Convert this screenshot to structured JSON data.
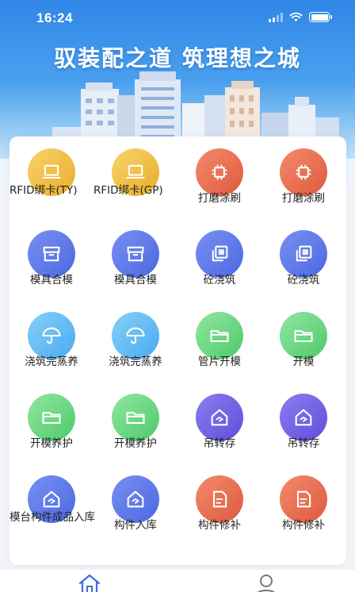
{
  "status": {
    "time": "16:24"
  },
  "header": {
    "slogan": "驭装配之道 筑理想之城"
  },
  "menu": [
    {
      "label": "RFID绑卡(TY)",
      "icon": "laptop-icon",
      "color": "yellow"
    },
    {
      "label": "RFID绑卡(GP)",
      "icon": "laptop-icon",
      "color": "yellow"
    },
    {
      "label": "打磨涂刷",
      "icon": "chip-icon",
      "color": "red"
    },
    {
      "label": "打磨涂刷",
      "icon": "chip-icon",
      "color": "red"
    },
    {
      "label": "模具合模",
      "icon": "box-icon",
      "color": "blue"
    },
    {
      "label": "模具合模",
      "icon": "box-icon",
      "color": "blue"
    },
    {
      "label": "砼浇筑",
      "icon": "layers-icon",
      "color": "blue"
    },
    {
      "label": "砼浇筑",
      "icon": "layers-icon",
      "color": "blue"
    },
    {
      "label": "浇筑完蒸养",
      "icon": "umbrella-icon",
      "color": "cyan"
    },
    {
      "label": "浇筑完蒸养",
      "icon": "umbrella-icon",
      "color": "cyan"
    },
    {
      "label": "管片开模",
      "icon": "folder-icon",
      "color": "green"
    },
    {
      "label": "开模",
      "icon": "folder-icon",
      "color": "green"
    },
    {
      "label": "开模养护",
      "icon": "folder-icon",
      "color": "green"
    },
    {
      "label": "开模养护",
      "icon": "folder-icon",
      "color": "green"
    },
    {
      "label": "吊转存",
      "icon": "house-icon",
      "color": "purple"
    },
    {
      "label": "吊转存",
      "icon": "house-icon",
      "color": "purple"
    },
    {
      "label": "模台构件成品入库",
      "icon": "house-icon",
      "color": "blue"
    },
    {
      "label": "构件入库",
      "icon": "house-icon",
      "color": "blue"
    },
    {
      "label": "构件修补",
      "icon": "document-icon",
      "color": "red"
    },
    {
      "label": "构件修补",
      "icon": "document-icon",
      "color": "red"
    }
  ],
  "tabbar": [
    {
      "name": "home",
      "icon": "home-icon",
      "active": true
    },
    {
      "name": "profile",
      "icon": "user-icon",
      "active": false
    }
  ]
}
